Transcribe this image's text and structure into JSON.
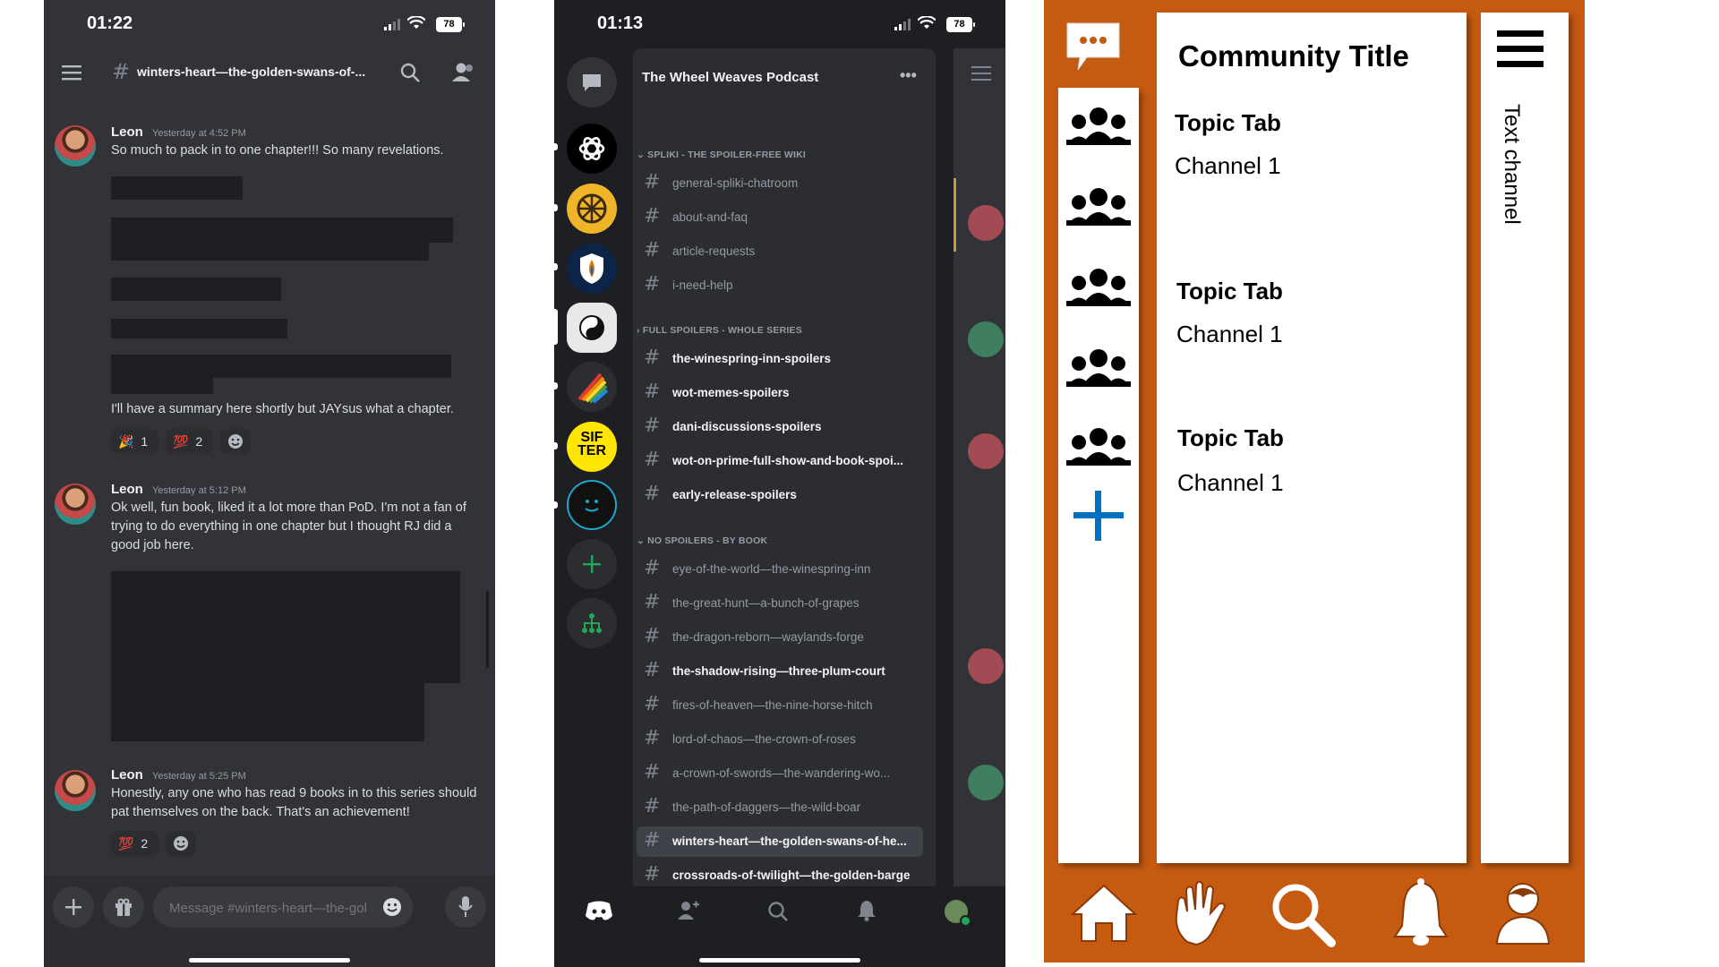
{
  "chat": {
    "status": {
      "time": "01:22",
      "battery": "78"
    },
    "channel_title": "winters-heart—the-golden-swans-of-...",
    "messages": [
      {
        "author": "Leon",
        "timestamp": "Yesterday at 4:52 PM",
        "text": "So much to pack in to one chapter!!! So many revelations."
      },
      {
        "text": "I'll have a summary here shortly but JAYsus what a chapter."
      },
      {
        "author": "Leon",
        "timestamp": "Yesterday at 5:12 PM",
        "text": "Ok well, fun book, liked it a lot more than PoD. I'm not a fan of trying to do everything in one chapter but I thought RJ did a good job here."
      },
      {
        "author": "Leon",
        "timestamp": "Yesterday at 5:25 PM",
        "text": "Honestly, any one who has read 9 books in to this series should pat themselves on the back. That's an achievement!"
      }
    ],
    "reactions1": [
      {
        "emoji": "🎉",
        "count": "1"
      },
      {
        "emoji": "💯",
        "count": "2"
      }
    ],
    "reactions2": [
      {
        "emoji": "💯",
        "count": "2"
      }
    ],
    "composer_placeholder": "Message #winters-heart—the-gold..."
  },
  "server_view": {
    "status": {
      "time": "01:13",
      "battery": "78"
    },
    "server_name": "The Wheel Weaves Podcast",
    "server_icon_text": "SIF TER",
    "categories": [
      {
        "name": "SPLIKI - THE SPOILER-FREE WIKI",
        "channels": [
          "general-spliki-chatroom",
          "about-and-faq",
          "article-requests",
          "i-need-help"
        ]
      },
      {
        "name": "FULL SPOILERS - WHOLE SERIES",
        "channels": [
          "the-winespring-inn-spoilers",
          "wot-memes-spoilers",
          "dani-discussions-spoilers",
          "wot-on-prime-full-show-and-book-spoi...",
          "early-release-spoilers"
        ]
      },
      {
        "name": "NO SPOILERS - BY BOOK",
        "channels": [
          "eye-of-the-world—the-winespring-inn",
          "the-great-hunt—a-bunch-of-grapes",
          "the-dragon-reborn—waylands-forge",
          "the-shadow-rising—three-plum-court",
          "fires-of-heaven—the-nine-horse-hitch",
          "lord-of-chaos—the-crown-of-roses",
          "a-crown-of-swords—the-wandering-wo...",
          "the-path-of-daggers—the-wild-boar",
          "winters-heart—the-golden-swans-of-he...",
          "crossroads-of-twilight—the-golden-barge"
        ]
      }
    ]
  },
  "mockup": {
    "community_title": "Community Title",
    "topics": [
      {
        "tab": "Topic Tab",
        "channel": "Channel 1"
      },
      {
        "tab": "Topic Tab",
        "channel": "Channel 1"
      },
      {
        "tab": "Topic Tab",
        "channel": "Channel 1"
      }
    ],
    "side_label": "Text channel",
    "colors": {
      "background": "#c55a11",
      "plus": "#0070c0"
    }
  }
}
